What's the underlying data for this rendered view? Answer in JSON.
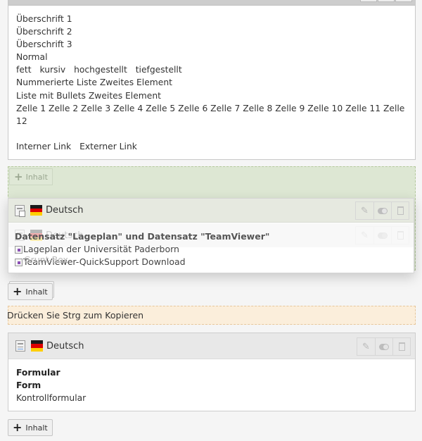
{
  "top_element": {
    "lines": [
      "Überschrift 1",
      "Überschrift 2",
      "Überschrift 3",
      "Normal"
    ],
    "formats": [
      "fett",
      "kursiv",
      "hochgestellt",
      "tiefgestellt"
    ],
    "list_lines": [
      "Nummerierte Liste Zweites Element",
      "Liste mit Bullets Zweites Element"
    ],
    "table_line": "Zelle 1 Zelle 2 Zelle 3 Zelle 4 Zelle 5 Zelle 6 Zelle 7 Zelle 8 Zelle 9 Zelle 10 Zelle 11 Zelle 12",
    "links": [
      "Interner Link",
      "Externer Link"
    ]
  },
  "dropzone": {
    "add_label": "Inhalt"
  },
  "dragged_element": {
    "language": "Deutsch",
    "ghost_language": "Deutsch",
    "title": "Datensatz \"Lageplan\" und Datensatz \"TeamViewer\"",
    "records": [
      "Lageplan der Universität Paderborn",
      "TeamViewer-QuickSupport Download"
    ],
    "ghost_overlay_text": "Grunt-Box"
  },
  "add_content_1": {
    "label": "Inhalt"
  },
  "copy_hint": "Drücken Sie Strg zum Kopieren",
  "bottom_element": {
    "language": "Deutsch",
    "lines": [
      {
        "text": "Formular",
        "bold": true
      },
      {
        "text": "Form",
        "bold": true
      },
      {
        "text": "Kontrollformular",
        "bold": false
      }
    ]
  },
  "add_content_2": {
    "label": "Inhalt"
  },
  "flag_colors": [
    "#1a1a1a",
    "#dd0000",
    "#ffce00"
  ],
  "icons": {
    "edit": "pencil-icon",
    "toggle": "visibility-toggle-icon",
    "delete": "trash-icon"
  }
}
